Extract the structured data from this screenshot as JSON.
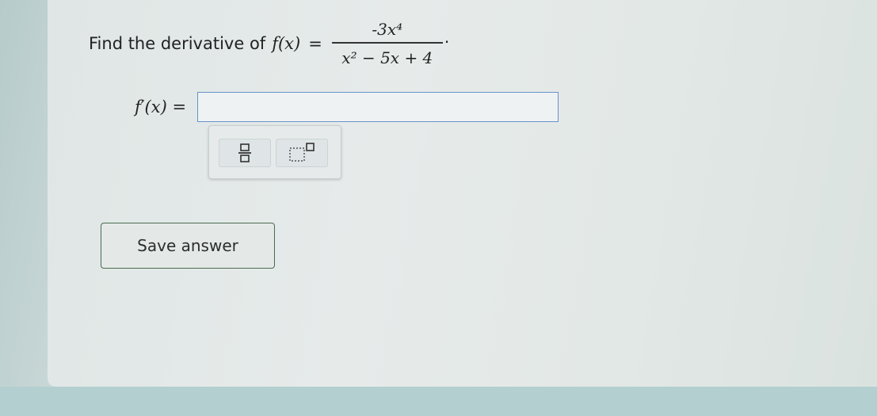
{
  "question": {
    "prefix": "Find the derivative of",
    "function_name": "f(x)",
    "equals": "=",
    "numerator": "-3x⁴",
    "denominator": "x² − 5x + 4",
    "period": "."
  },
  "answer": {
    "label": "f′(x) =",
    "value": ""
  },
  "toolbar": {
    "buttons": [
      {
        "name": "fraction",
        "icon": "fraction-icon"
      },
      {
        "name": "exponent",
        "icon": "exponent-icon"
      }
    ]
  },
  "save_button": {
    "label": "Save answer"
  },
  "colors": {
    "input_border": "#6a93c9",
    "save_border": "#4a6b4f",
    "background": "#e3e9e8"
  }
}
